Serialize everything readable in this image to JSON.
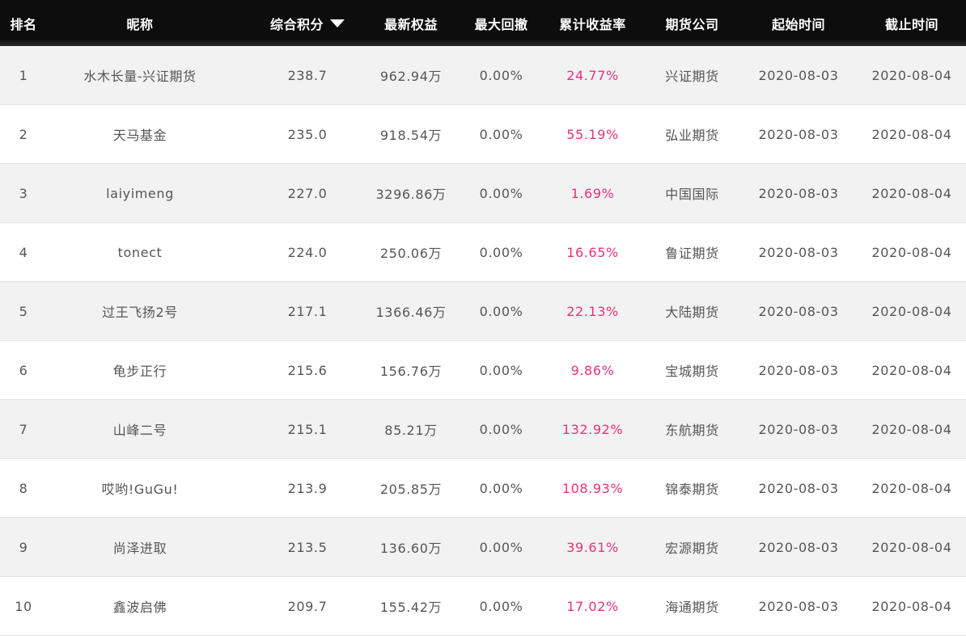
{
  "headers": {
    "rank": "排名",
    "nickname": "昵称",
    "score": "综合积分",
    "equity": "最新权益",
    "drawdown": "最大回撤",
    "return": "累计收益率",
    "company": "期货公司",
    "start": "起始时间",
    "end": "截止时间",
    "sort_icon": "caret-down-icon"
  },
  "colors": {
    "header_bg": "#0d0d0d",
    "header_text": "#ffffff",
    "row_alt_bg": "#f2f2f2",
    "text": "#555555",
    "return_text": "#e8317a"
  },
  "rows": [
    {
      "rank": "1",
      "nickname": "水木长量-兴证期货",
      "score": "238.7",
      "equity": "962.94万",
      "drawdown": "0.00%",
      "return": "24.77%",
      "company": "兴证期货",
      "start": "2020-08-03",
      "end": "2020-08-04"
    },
    {
      "rank": "2",
      "nickname": "天马基金",
      "score": "235.0",
      "equity": "918.54万",
      "drawdown": "0.00%",
      "return": "55.19%",
      "company": "弘业期货",
      "start": "2020-08-03",
      "end": "2020-08-04"
    },
    {
      "rank": "3",
      "nickname": "laiyimeng",
      "score": "227.0",
      "equity": "3296.86万",
      "drawdown": "0.00%",
      "return": "1.69%",
      "company": "中国国际",
      "start": "2020-08-03",
      "end": "2020-08-04"
    },
    {
      "rank": "4",
      "nickname": "tonect",
      "score": "224.0",
      "equity": "250.06万",
      "drawdown": "0.00%",
      "return": "16.65%",
      "company": "鲁证期货",
      "start": "2020-08-03",
      "end": "2020-08-04"
    },
    {
      "rank": "5",
      "nickname": "过王飞扬2号",
      "score": "217.1",
      "equity": "1366.46万",
      "drawdown": "0.00%",
      "return": "22.13%",
      "company": "大陆期货",
      "start": "2020-08-03",
      "end": "2020-08-04"
    },
    {
      "rank": "6",
      "nickname": "龟步正行",
      "score": "215.6",
      "equity": "156.76万",
      "drawdown": "0.00%",
      "return": "9.86%",
      "company": "宝城期货",
      "start": "2020-08-03",
      "end": "2020-08-04"
    },
    {
      "rank": "7",
      "nickname": "山峰二号",
      "score": "215.1",
      "equity": "85.21万",
      "drawdown": "0.00%",
      "return": "132.92%",
      "company": "东航期货",
      "start": "2020-08-03",
      "end": "2020-08-04"
    },
    {
      "rank": "8",
      "nickname": "哎哟!GuGu!",
      "score": "213.9",
      "equity": "205.85万",
      "drawdown": "0.00%",
      "return": "108.93%",
      "company": "锦泰期货",
      "start": "2020-08-03",
      "end": "2020-08-04"
    },
    {
      "rank": "9",
      "nickname": "尚泽进取",
      "score": "213.5",
      "equity": "136.60万",
      "drawdown": "0.00%",
      "return": "39.61%",
      "company": "宏源期货",
      "start": "2020-08-03",
      "end": "2020-08-04"
    },
    {
      "rank": "10",
      "nickname": "鑫波启佛",
      "score": "209.7",
      "equity": "155.42万",
      "drawdown": "0.00%",
      "return": "17.02%",
      "company": "海通期货",
      "start": "2020-08-03",
      "end": "2020-08-04"
    }
  ]
}
